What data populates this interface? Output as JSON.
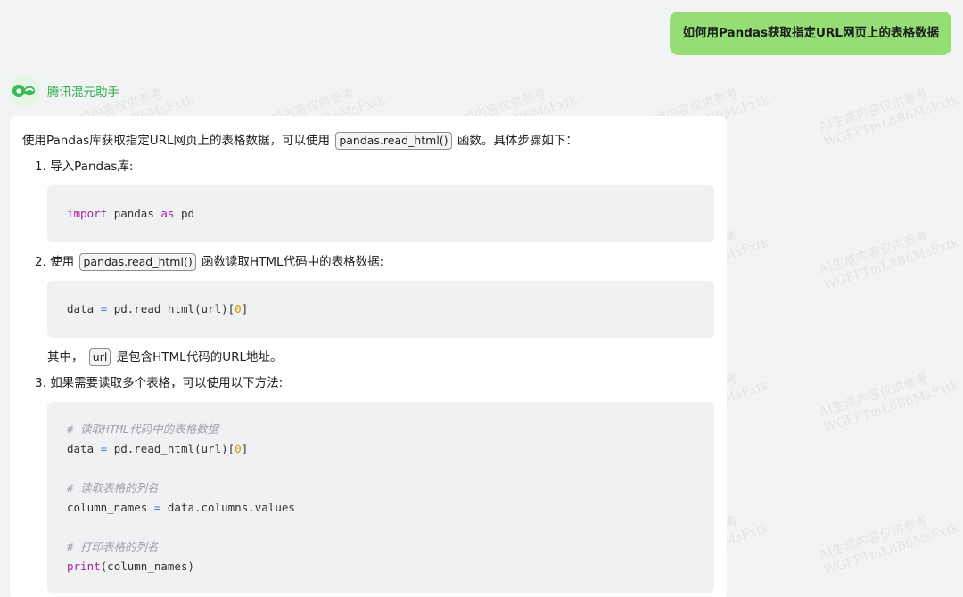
{
  "user_message": "如何用Pandas获取指定URL网页上的表格数据",
  "assistant": {
    "name": "腾讯混元助手"
  },
  "answer": {
    "intro_before": "使用Pandas库获取指定URL网页上的表格数据，可以使用",
    "intro_code": "pandas.read_html()",
    "intro_after": "函数。具体步骤如下：",
    "step1": {
      "num": "1.",
      "text": "导入Pandas库:"
    },
    "code1": {
      "kw_import": "import",
      "mod": "pandas",
      "kw_as": "as",
      "alias": "pd"
    },
    "step2": {
      "num": "2.",
      "before": "使用",
      "code": "pandas.read_html()",
      "after": "函数读取HTML代码中的表格数据:"
    },
    "code2": {
      "var": "data",
      "op": "=",
      "call": "pd.read_html(url)[",
      "idx": "0",
      "close": "]"
    },
    "note": {
      "before": "其中，",
      "code": "url",
      "after": "是包含HTML代码的URL地址。"
    },
    "step3": {
      "num": "3.",
      "text": "如果需要读取多个表格，可以使用以下方法:"
    },
    "code3": {
      "comment1": "# 读取HTML代码中的表格数据",
      "var1": "data",
      "op1": "=",
      "call1": "pd.read_html(url)[",
      "idx1": "0",
      "close1": "]",
      "comment2": "# 读取表格的列名",
      "var2": "column_names",
      "op2": "=",
      "expr2": "data.columns.values",
      "comment3": "# 打印表格的列名",
      "fn3": "print",
      "args3": "(column_names)"
    }
  },
  "watermark": {
    "line1": "AI生成内容仅供参考",
    "line2": "WGFPTmL8B6MsFxtk"
  },
  "colors": {
    "user_bubble": "#95de76",
    "assistant_name": "#2eae4a",
    "background": "#f2f3f5"
  }
}
